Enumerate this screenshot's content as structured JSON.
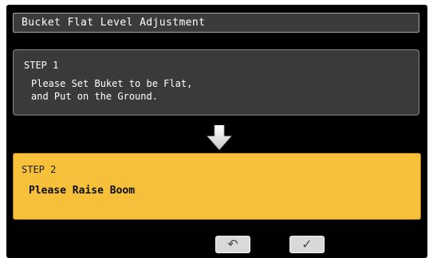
{
  "title": "Bucket Flat Level Adjustment",
  "step1": {
    "label": "STEP 1",
    "lines": [
      "Please Set Buket to be Flat,",
      "and Put on the Ground."
    ]
  },
  "step2": {
    "label": "STEP 2",
    "text": "Please Raise Boom"
  },
  "buttons": {
    "back_icon": "↶",
    "confirm_icon": "✓"
  },
  "icons": {
    "arrow": "arrow-down-icon",
    "back": "back-icon",
    "confirm": "check-icon"
  },
  "colors": {
    "active_step_bg": "#f7c03a",
    "inactive_step_bg": "#3a3a3a",
    "screen_bg": "#000000"
  }
}
